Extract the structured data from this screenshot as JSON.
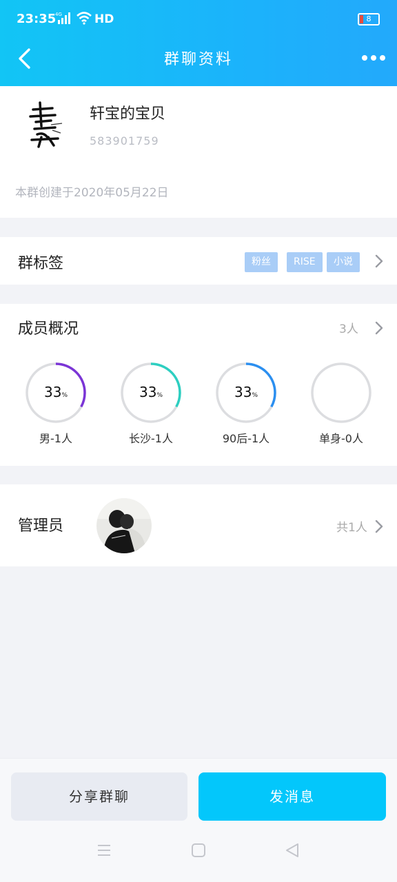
{
  "status_bar": {
    "time": "23:35",
    "network": "HD",
    "battery": "8",
    "signal_label": "4G"
  },
  "nav": {
    "title": "群聊资料"
  },
  "group": {
    "name": "轩宝的宝贝",
    "id": "583901759",
    "created": "本群创建于2020年05月22日"
  },
  "tags_section": {
    "label": "群标签",
    "tags": [
      "粉丝",
      "RISE",
      "小说"
    ]
  },
  "members_section": {
    "label": "成员概况",
    "count": "3人",
    "stats": [
      {
        "percent": "33",
        "unit": "%",
        "label": "男-1人",
        "fraction": 0.33,
        "color": "#7b35d6"
      },
      {
        "percent": "33",
        "unit": "%",
        "label": "长沙-1人",
        "fraction": 0.33,
        "color": "#2dcfc1"
      },
      {
        "percent": "33",
        "unit": "%",
        "label": "90后-1人",
        "fraction": 0.33,
        "color": "#2b8ff0"
      },
      {
        "percent": "",
        "unit": "",
        "label": "单身-0人",
        "fraction": 0,
        "color": "#cccccc"
      }
    ]
  },
  "admin_section": {
    "label": "管理员",
    "count": "共1人"
  },
  "buttons": {
    "share": "分享群聊",
    "send": "发消息"
  },
  "colors": {
    "accent": "#03c7fb",
    "tag_bg": "#a9cdf7"
  }
}
